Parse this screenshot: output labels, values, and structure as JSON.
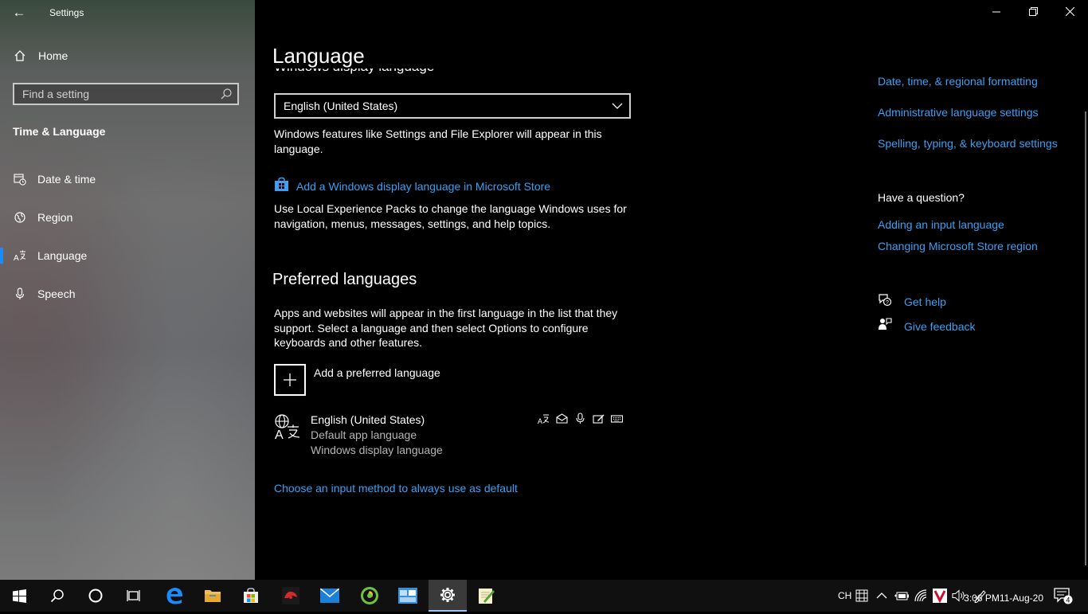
{
  "window": {
    "app_title": "Settings",
    "back_label": "←",
    "minimize_label": "—",
    "close_label": "✕"
  },
  "sidebar": {
    "home_label": "Home",
    "search_placeholder": "Find a setting",
    "section_title": "Time & Language",
    "items": [
      {
        "label": "Date & time",
        "icon": "calendar-clock-icon"
      },
      {
        "label": "Region",
        "icon": "globe-region-icon"
      },
      {
        "label": "Language",
        "icon": "language-icon",
        "active": true
      },
      {
        "label": "Speech",
        "icon": "microphone-icon"
      }
    ]
  },
  "main": {
    "page_title": "Language",
    "partial_heading": "Windows display language",
    "display_language_value": "English (United States)",
    "display_language_desc": "Windows features like Settings and File Explorer will appear in this language.",
    "store_link": "Add a Windows display language in Microsoft Store",
    "lep_desc": "Use Local Experience Packs to change the language Windows uses for navigation, menus, messages, settings, and help topics.",
    "preferred_heading": "Preferred languages",
    "preferred_desc": "Apps and websites will appear in the first language in the list that they support. Select a language and then select Options to configure keyboards and other features.",
    "add_language_label": "Add a preferred language",
    "language_entry": {
      "name": "English (United States)",
      "sub1": "Default app language",
      "sub2": "Windows display language",
      "feature_icons": [
        "display-language-icon",
        "text-to-speech-icon",
        "speech-recognition-icon",
        "handwriting-icon",
        "keyboard-icon"
      ]
    },
    "input_method_link": "Choose an input method to always use as default"
  },
  "related": {
    "links": [
      "Date, time, & regional formatting",
      "Administrative language settings",
      "Spelling, typing, & keyboard settings"
    ],
    "question_heading": "Have a question?",
    "question_links": [
      "Adding an input language",
      "Changing Microsoft Store region"
    ],
    "get_help": "Get help",
    "give_feedback": "Give feedback"
  },
  "taskbar": {
    "input_lang": "CH",
    "time": "3:06 PM",
    "date": "11-Aug-20",
    "notification_count": "4",
    "apps": [
      "windows-start-icon",
      "search-icon",
      "cortana-icon",
      "task-view-icon",
      "edge-icon",
      "file-explorer-icon",
      "microsoft-store-icon",
      "game-app-icon",
      "mail-icon",
      "green-app-icon",
      "app-window-icon",
      "settings-gear-icon",
      "notepad-icon"
    ]
  },
  "colors": {
    "accent_link": "#3aa0f3",
    "active_indicator": "#1a8cff",
    "background": "#000000"
  }
}
